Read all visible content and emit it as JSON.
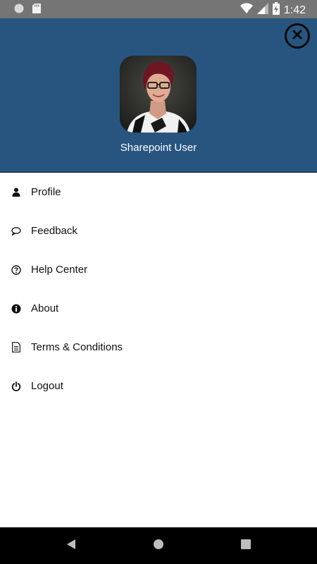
{
  "status_bar": {
    "time": "1:42",
    "icons": [
      "circle-icon",
      "sd-card-icon",
      "wifi-icon",
      "signal-icon",
      "battery-charging-icon"
    ]
  },
  "drawer": {
    "user_name": "Sharepoint User",
    "close_icon": "close-circle-icon",
    "header_color": "#275580"
  },
  "menu": {
    "items": [
      {
        "label": "Profile",
        "icon": "user-icon"
      },
      {
        "label": "Feedback",
        "icon": "comment-icon"
      },
      {
        "label": "Help Center",
        "icon": "help-circle-icon"
      },
      {
        "label": "About",
        "icon": "info-circle-icon"
      },
      {
        "label": "Terms & Conditions",
        "icon": "document-icon"
      },
      {
        "label": "Logout",
        "icon": "power-icon"
      }
    ]
  },
  "nav_bar": {
    "buttons": [
      "back-icon",
      "home-icon",
      "recents-icon"
    ]
  }
}
